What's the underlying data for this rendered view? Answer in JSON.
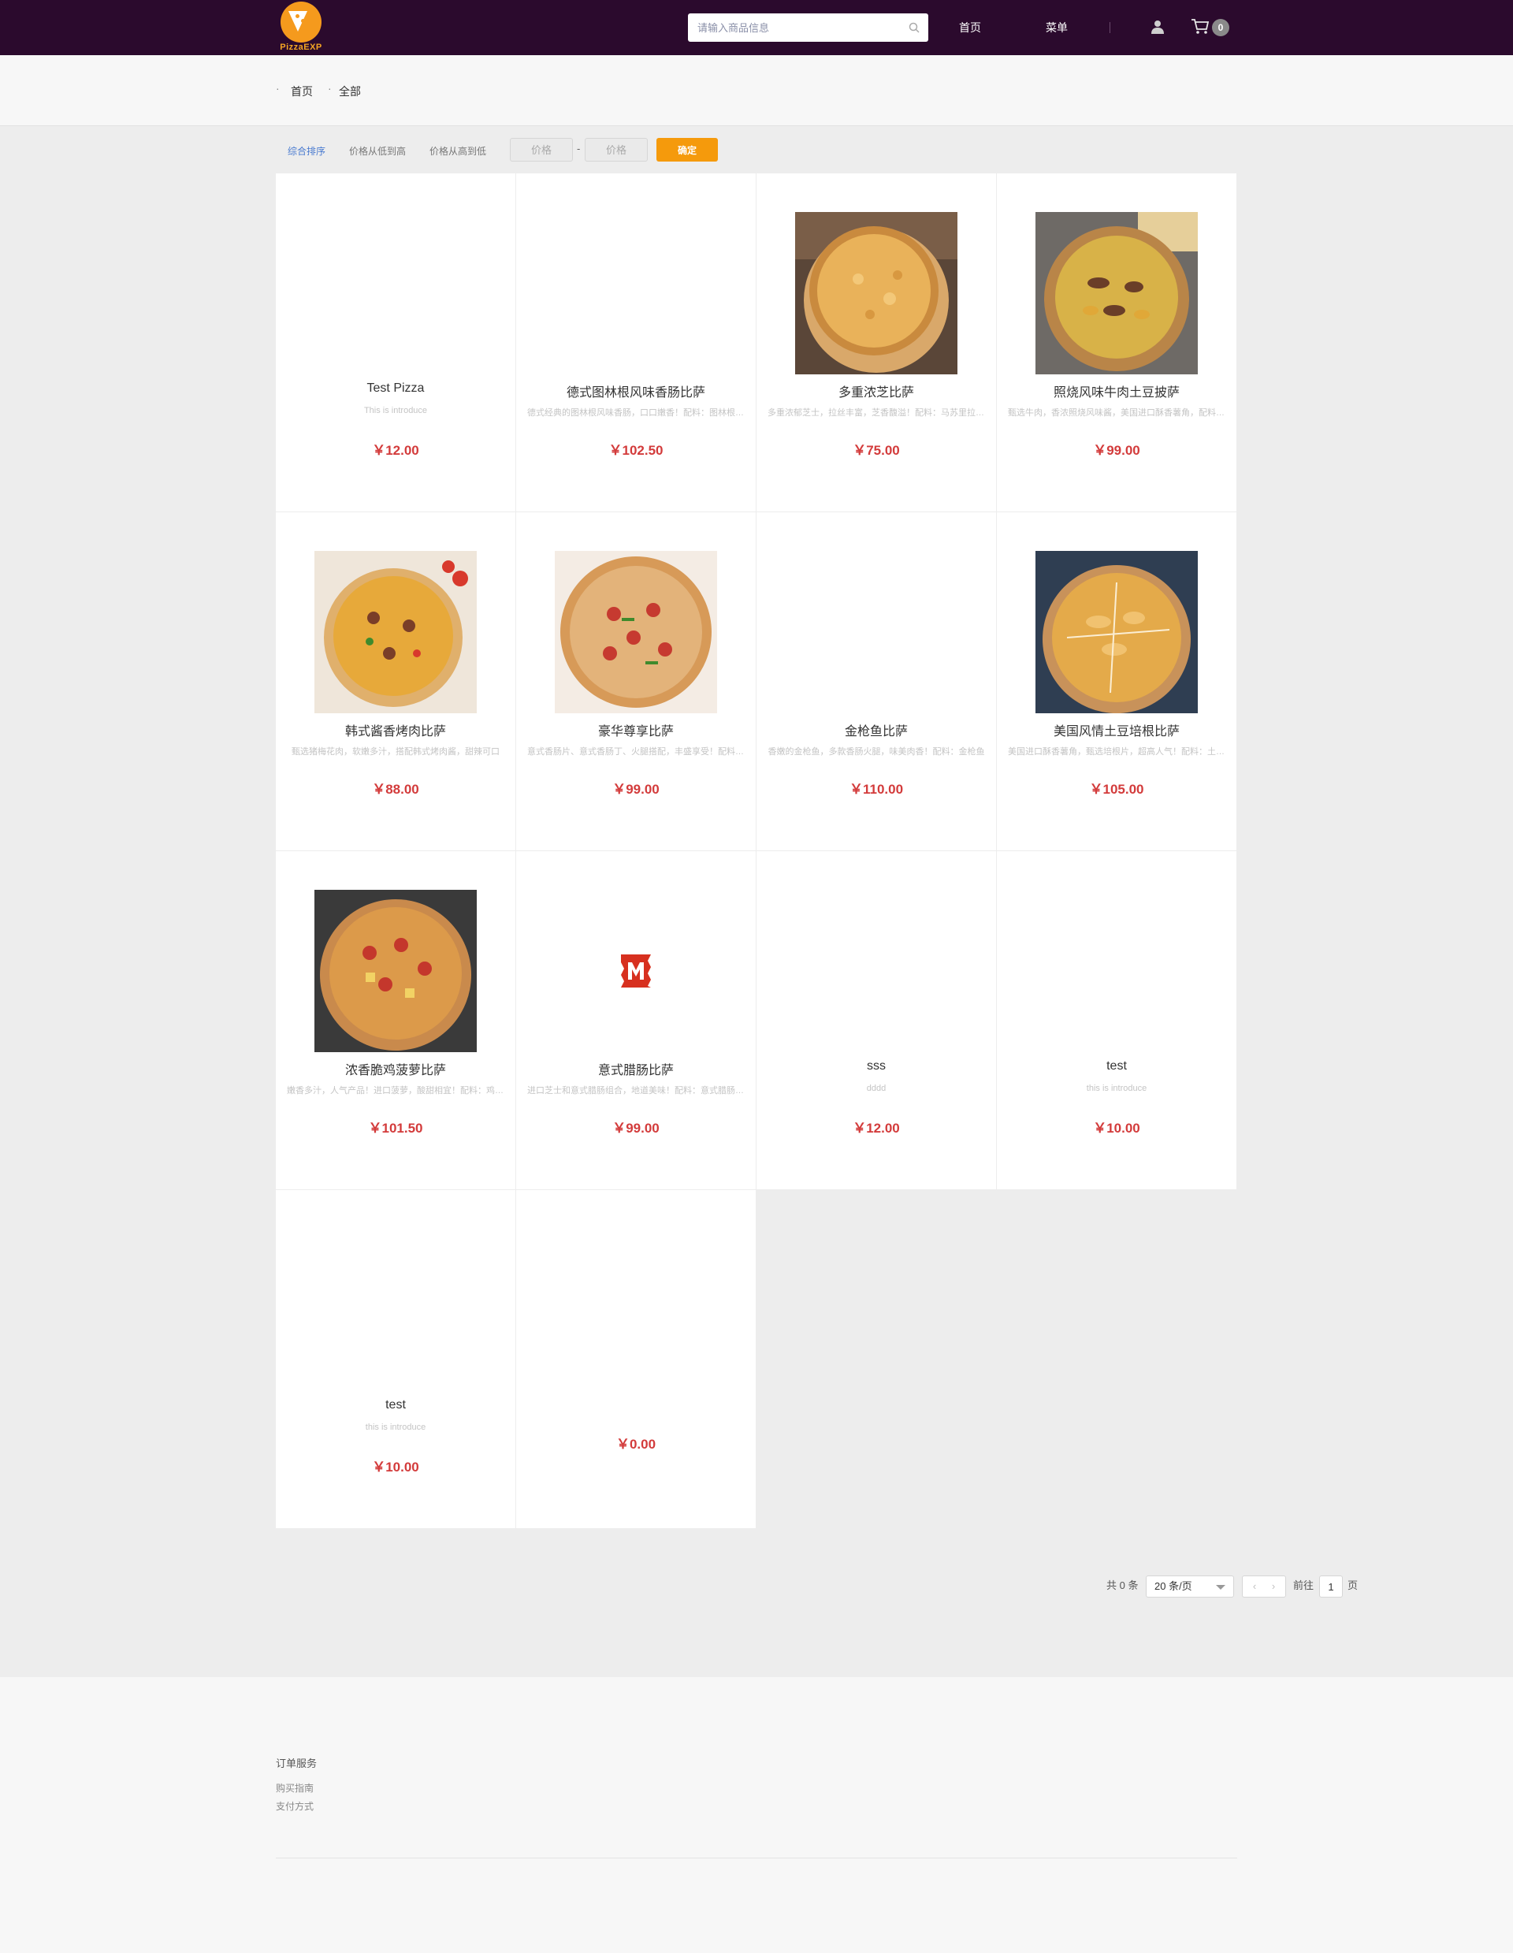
{
  "header": {
    "logo_text": "PizzaEXP",
    "search_placeholder": "请输入商品信息",
    "nav": [
      "首页",
      "菜单"
    ],
    "cart_count": "0"
  },
  "breadcrumb": [
    "首页",
    "全部"
  ],
  "sort": {
    "options": [
      "综合排序",
      "价格从低到高",
      "价格从高到低"
    ],
    "active": "综合排序",
    "min_placeholder": "价格",
    "max_placeholder": "价格",
    "separator": "-",
    "confirm_label": "确定"
  },
  "products": [
    {
      "name": "Test Pizza",
      "desc": "This is introduce",
      "price": "￥12.00"
    },
    {
      "name": "德式图林根风味香肠比萨",
      "desc": "德式经典的图林根风味香肠，口口嫩香！配料：图林根香肠、马苏里拉芝士",
      "price": "￥102.50"
    },
    {
      "name": "多重浓芝比萨",
      "desc": "多重浓郁芝士，拉丝丰富，芝香馥溢！配料：马苏里拉芝士、切达芝士",
      "price": "￥75.00"
    },
    {
      "name": "照烧风味牛肉土豆披萨",
      "desc": "甄选牛肉，香浓照烧风味酱，美国进口酥香薯角，配料丰富",
      "price": "￥99.00"
    },
    {
      "name": "韩式酱香烤肉比萨",
      "desc": "甄选猪梅花肉，软嫩多汁，搭配韩式烤肉酱，甜辣可口",
      "price": "￥88.00"
    },
    {
      "name": "豪华尊享比萨",
      "desc": "意式香肠片、意式香肠丁、火腿搭配，丰盛享受！配料丰富",
      "price": "￥99.00"
    },
    {
      "name": "金枪鱼比萨",
      "desc": "香嫩的金枪鱼，多款香肠火腿，味美肉香！配料：金枪鱼",
      "price": "￥110.00"
    },
    {
      "name": "美国风情土豆培根比萨",
      "desc": "美国进口酥香薯角，甄选培根片，超高人气！配料：土豆、培根",
      "price": "￥105.00"
    },
    {
      "name": "浓香脆鸡菠萝比萨",
      "desc": "嫩香多汁，人气产品！进口菠萝，酸甜相宜！配料：鸡肉、菠萝",
      "price": "￥101.50"
    },
    {
      "name": "意式腊肠比萨",
      "desc": "进口芝士和意式腊肠组合，地道美味！配料：意式腊肠、芝士",
      "price": "￥99.00"
    },
    {
      "name": "sss",
      "desc": "dddd",
      "price": "￥12.00"
    },
    {
      "name": "test",
      "desc": "this is introduce",
      "price": "￥10.00"
    },
    {
      "name": "test",
      "desc": "this is introduce",
      "price": "￥10.00"
    },
    {
      "name": "",
      "desc": "",
      "price": "￥0.00"
    }
  ],
  "pagination": {
    "total": "共 0 条",
    "page_size": "20 条/页",
    "goto_label": "前往",
    "page": "1",
    "page_suffix": "页"
  },
  "footer": {
    "section_title": "订单服务",
    "links": [
      "购买指南",
      "支付方式"
    ]
  },
  "colors": {
    "header_bg": "#2b0a2d",
    "accent": "#f59a0c",
    "price": "#d33b3b",
    "active_sort": "#4a7bd0"
  }
}
